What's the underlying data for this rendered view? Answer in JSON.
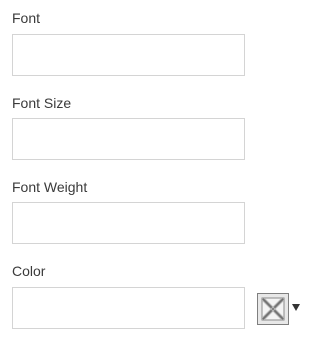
{
  "form": {
    "font": {
      "label": "Font",
      "value": ""
    },
    "font_size": {
      "label": "Font Size",
      "value": ""
    },
    "font_weight": {
      "label": "Font Weight",
      "value": ""
    },
    "color": {
      "label": "Color",
      "value": ""
    }
  },
  "color_picker": {
    "swatch_icon": "no-color-icon",
    "dropdown_icon": "triangle-down-icon",
    "swatch_border": "#7f7f7f",
    "swatch_fill": "#e8e8e8"
  }
}
